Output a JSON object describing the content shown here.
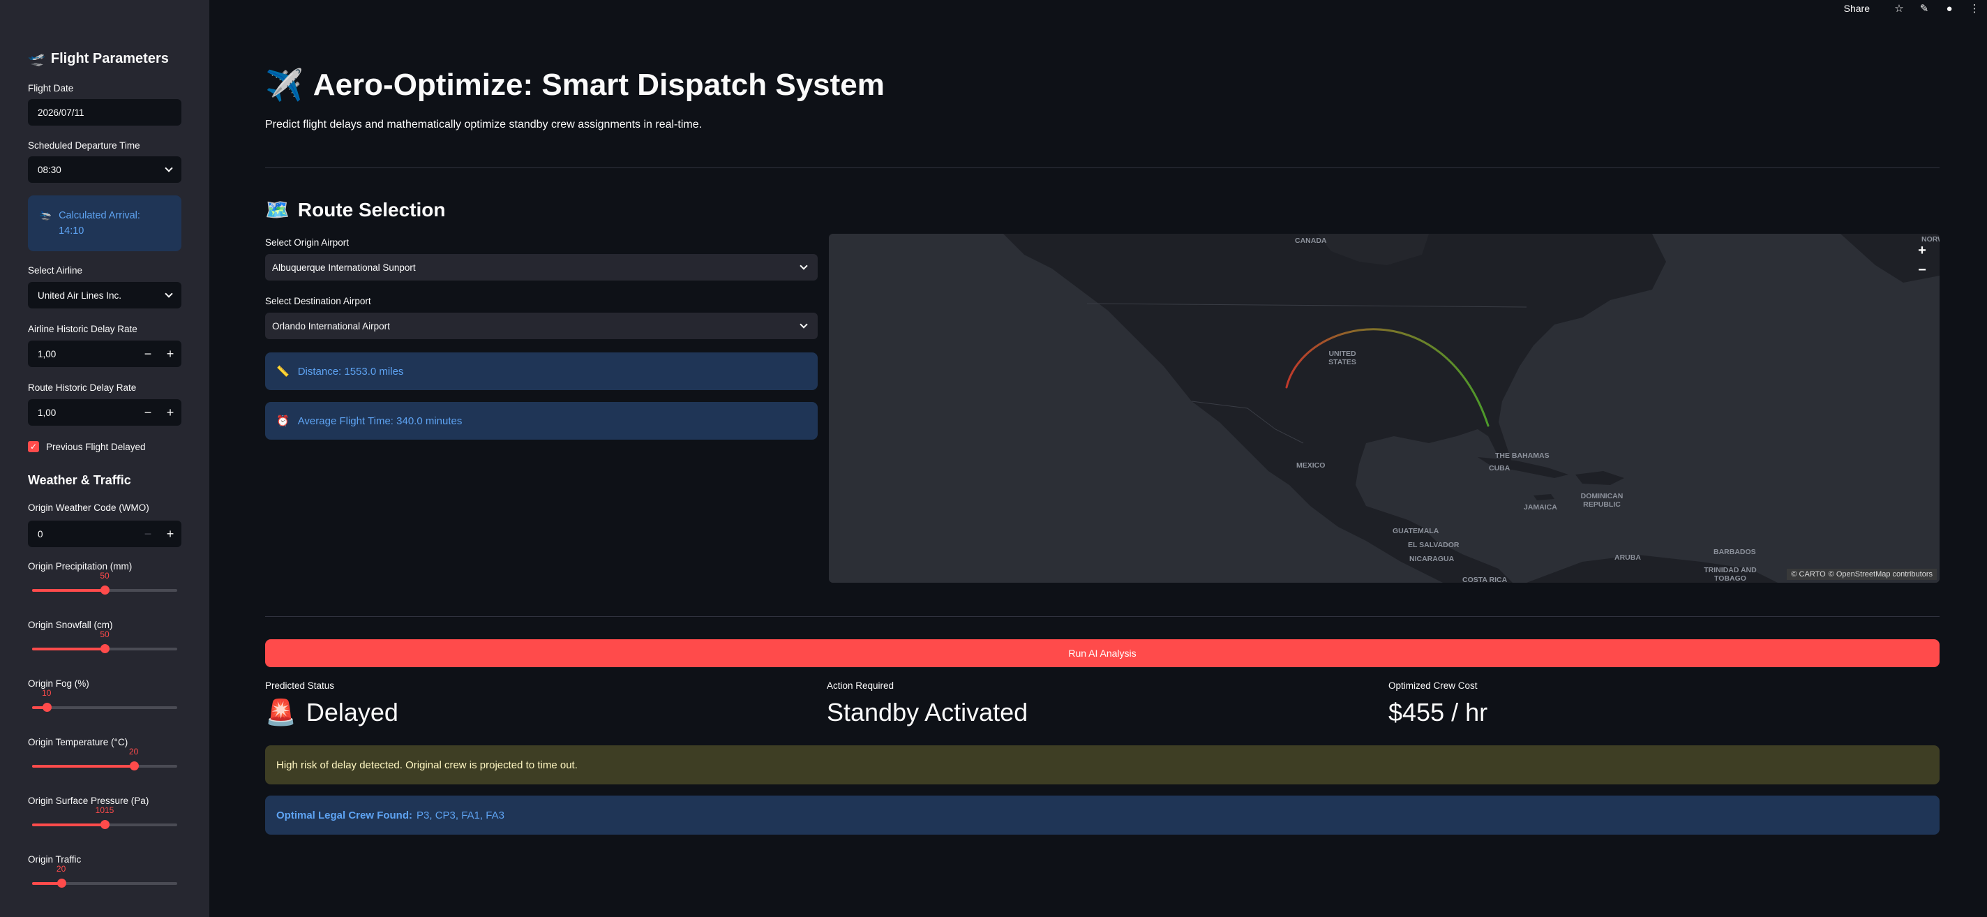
{
  "toolbar": {
    "share": "Share"
  },
  "sidebar": {
    "title": "Flight Parameters",
    "flight_date_label": "Flight Date",
    "flight_date_value": "2026/07/11",
    "departure_label": "Scheduled Departure Time",
    "departure_value": "08:30",
    "arrival_text_1": "Calculated Arrival:",
    "arrival_text_2": "14:10",
    "airline_label": "Select Airline",
    "airline_value": "United Air Lines Inc.",
    "airline_delay_label": "Airline Historic Delay Rate",
    "airline_delay_value": "1,00",
    "route_delay_label": "Route Historic Delay Rate",
    "route_delay_value": "1,00",
    "prev_delayed_label": "Previous Flight Delayed",
    "weather_section": "Weather & Traffic",
    "weather_code_label": "Origin Weather Code (WMO)",
    "weather_code_value": "0",
    "sliders": [
      {
        "label": "Origin Precipitation (mm)",
        "value": "50",
        "fraction": 0.5
      },
      {
        "label": "Origin Snowfall (cm)",
        "value": "50",
        "fraction": 0.5
      },
      {
        "label": "Origin Fog (%)",
        "value": "10",
        "fraction": 0.1
      },
      {
        "label": "Origin Temperature (°C)",
        "value": "20",
        "fraction": 0.7
      },
      {
        "label": "Origin Surface Pressure (Pa)",
        "value": "1015",
        "fraction": 0.5
      },
      {
        "label": "Origin Traffic",
        "value": "20",
        "fraction": 0.2
      }
    ]
  },
  "main": {
    "title": "Aero-Optimize: Smart Dispatch System",
    "subtitle": "Predict flight delays and mathematically optimize standby crew assignments in real-time.",
    "route_heading": "Route Selection",
    "origin_label": "Select Origin Airport",
    "origin_value": "Albuquerque International Sunport",
    "dest_label": "Select Destination Airport",
    "dest_value": "Orlando International Airport",
    "distance": "Distance: 1553.0 miles",
    "flight_time": "Average Flight Time: 340.0 minutes",
    "map": {
      "labels": [
        "CANADA",
        "UNITED STATES",
        "MEXICO",
        "THE BAHAMAS",
        "CUBA",
        "DOMINICAN REPUBLIC",
        "JAMAICA",
        "GUATEMALA",
        "EL SALVADOR",
        "NICARAGUA",
        "COSTA RICA",
        "ARUBA",
        "BARBADOS",
        "TRINIDAD AND TOBAGO",
        "NORW"
      ],
      "zoom_in": "+",
      "zoom_out": "−",
      "attribution_1": "© CARTO",
      "attribution_2": "© OpenStreetMap contributors"
    },
    "run_button": "Run AI Analysis",
    "predicted_label": "Predicted Status",
    "predicted_value": "Delayed",
    "action_label": "Action Required",
    "action_value": "Standby Activated",
    "cost_label": "Optimized Crew Cost",
    "cost_value": "$455 / hr",
    "warning": "High risk of delay detected. Original crew is projected to time out.",
    "crew_label": "Optimal Legal Crew Found:",
    "crew_value": "P3, CP3, FA1, FA3"
  }
}
